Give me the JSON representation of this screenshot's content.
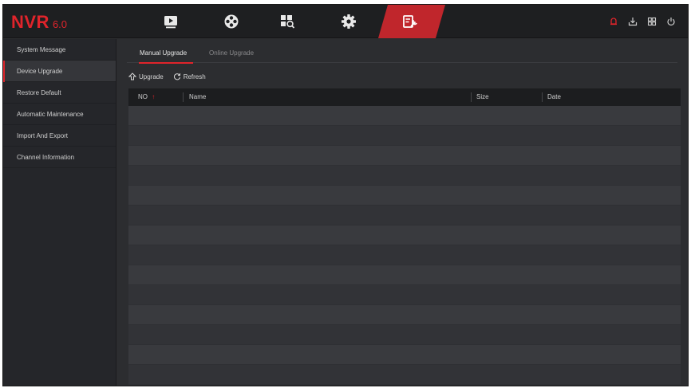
{
  "app": {
    "brand": "NVR",
    "version": "6.0"
  },
  "colors": {
    "accent": "#e0242b",
    "background": "#2c2d30",
    "sidebar": "#25262a"
  },
  "top_nav": [
    {
      "name": "playback-icon",
      "active": false
    },
    {
      "name": "live-view-icon",
      "active": false
    },
    {
      "name": "search-icon",
      "active": false
    },
    {
      "name": "settings-icon",
      "active": false
    },
    {
      "name": "system-maintenance-icon",
      "active": true
    }
  ],
  "system_icons": [
    "alarm-icon",
    "download-icon",
    "multi-screen-icon",
    "power-icon"
  ],
  "sidebar": {
    "items": [
      {
        "label": "System Message",
        "active": false
      },
      {
        "label": "Device Upgrade",
        "active": true
      },
      {
        "label": "Restore Default",
        "active": false
      },
      {
        "label": "Automatic Maintenance",
        "active": false
      },
      {
        "label": "Import And Export",
        "active": false
      },
      {
        "label": "Channel Information",
        "active": false
      }
    ]
  },
  "tabs": [
    {
      "label": "Manual Upgrade",
      "active": true
    },
    {
      "label": "Online Upgrade",
      "active": false
    }
  ],
  "toolbar": {
    "upgrade_label": "Upgrade",
    "refresh_label": "Refresh"
  },
  "table": {
    "columns": [
      "NO",
      "Name",
      "Size",
      "Date"
    ],
    "sort_indicator": "↑",
    "rows": []
  }
}
